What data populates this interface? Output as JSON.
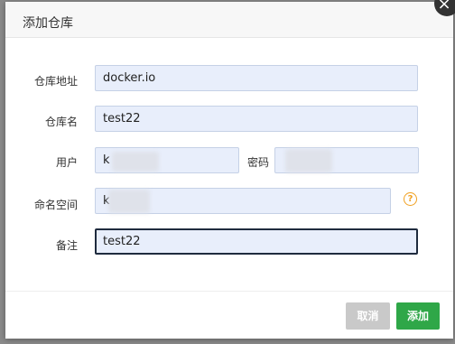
{
  "dialog": {
    "title": "添加仓库",
    "close_glyph": "×"
  },
  "form": {
    "registry_address": {
      "label": "仓库地址",
      "value": "docker.io"
    },
    "registry_name": {
      "label": "仓库名",
      "value": "test22"
    },
    "user": {
      "label": "用户",
      "value": "k"
    },
    "password": {
      "label": "密码",
      "value": ""
    },
    "namespace": {
      "label": "命名空间",
      "value": "k"
    },
    "remark": {
      "label": "备注",
      "value": "test22"
    }
  },
  "help_glyph": "?",
  "buttons": {
    "cancel_label": "取消",
    "add_label": "添加"
  }
}
